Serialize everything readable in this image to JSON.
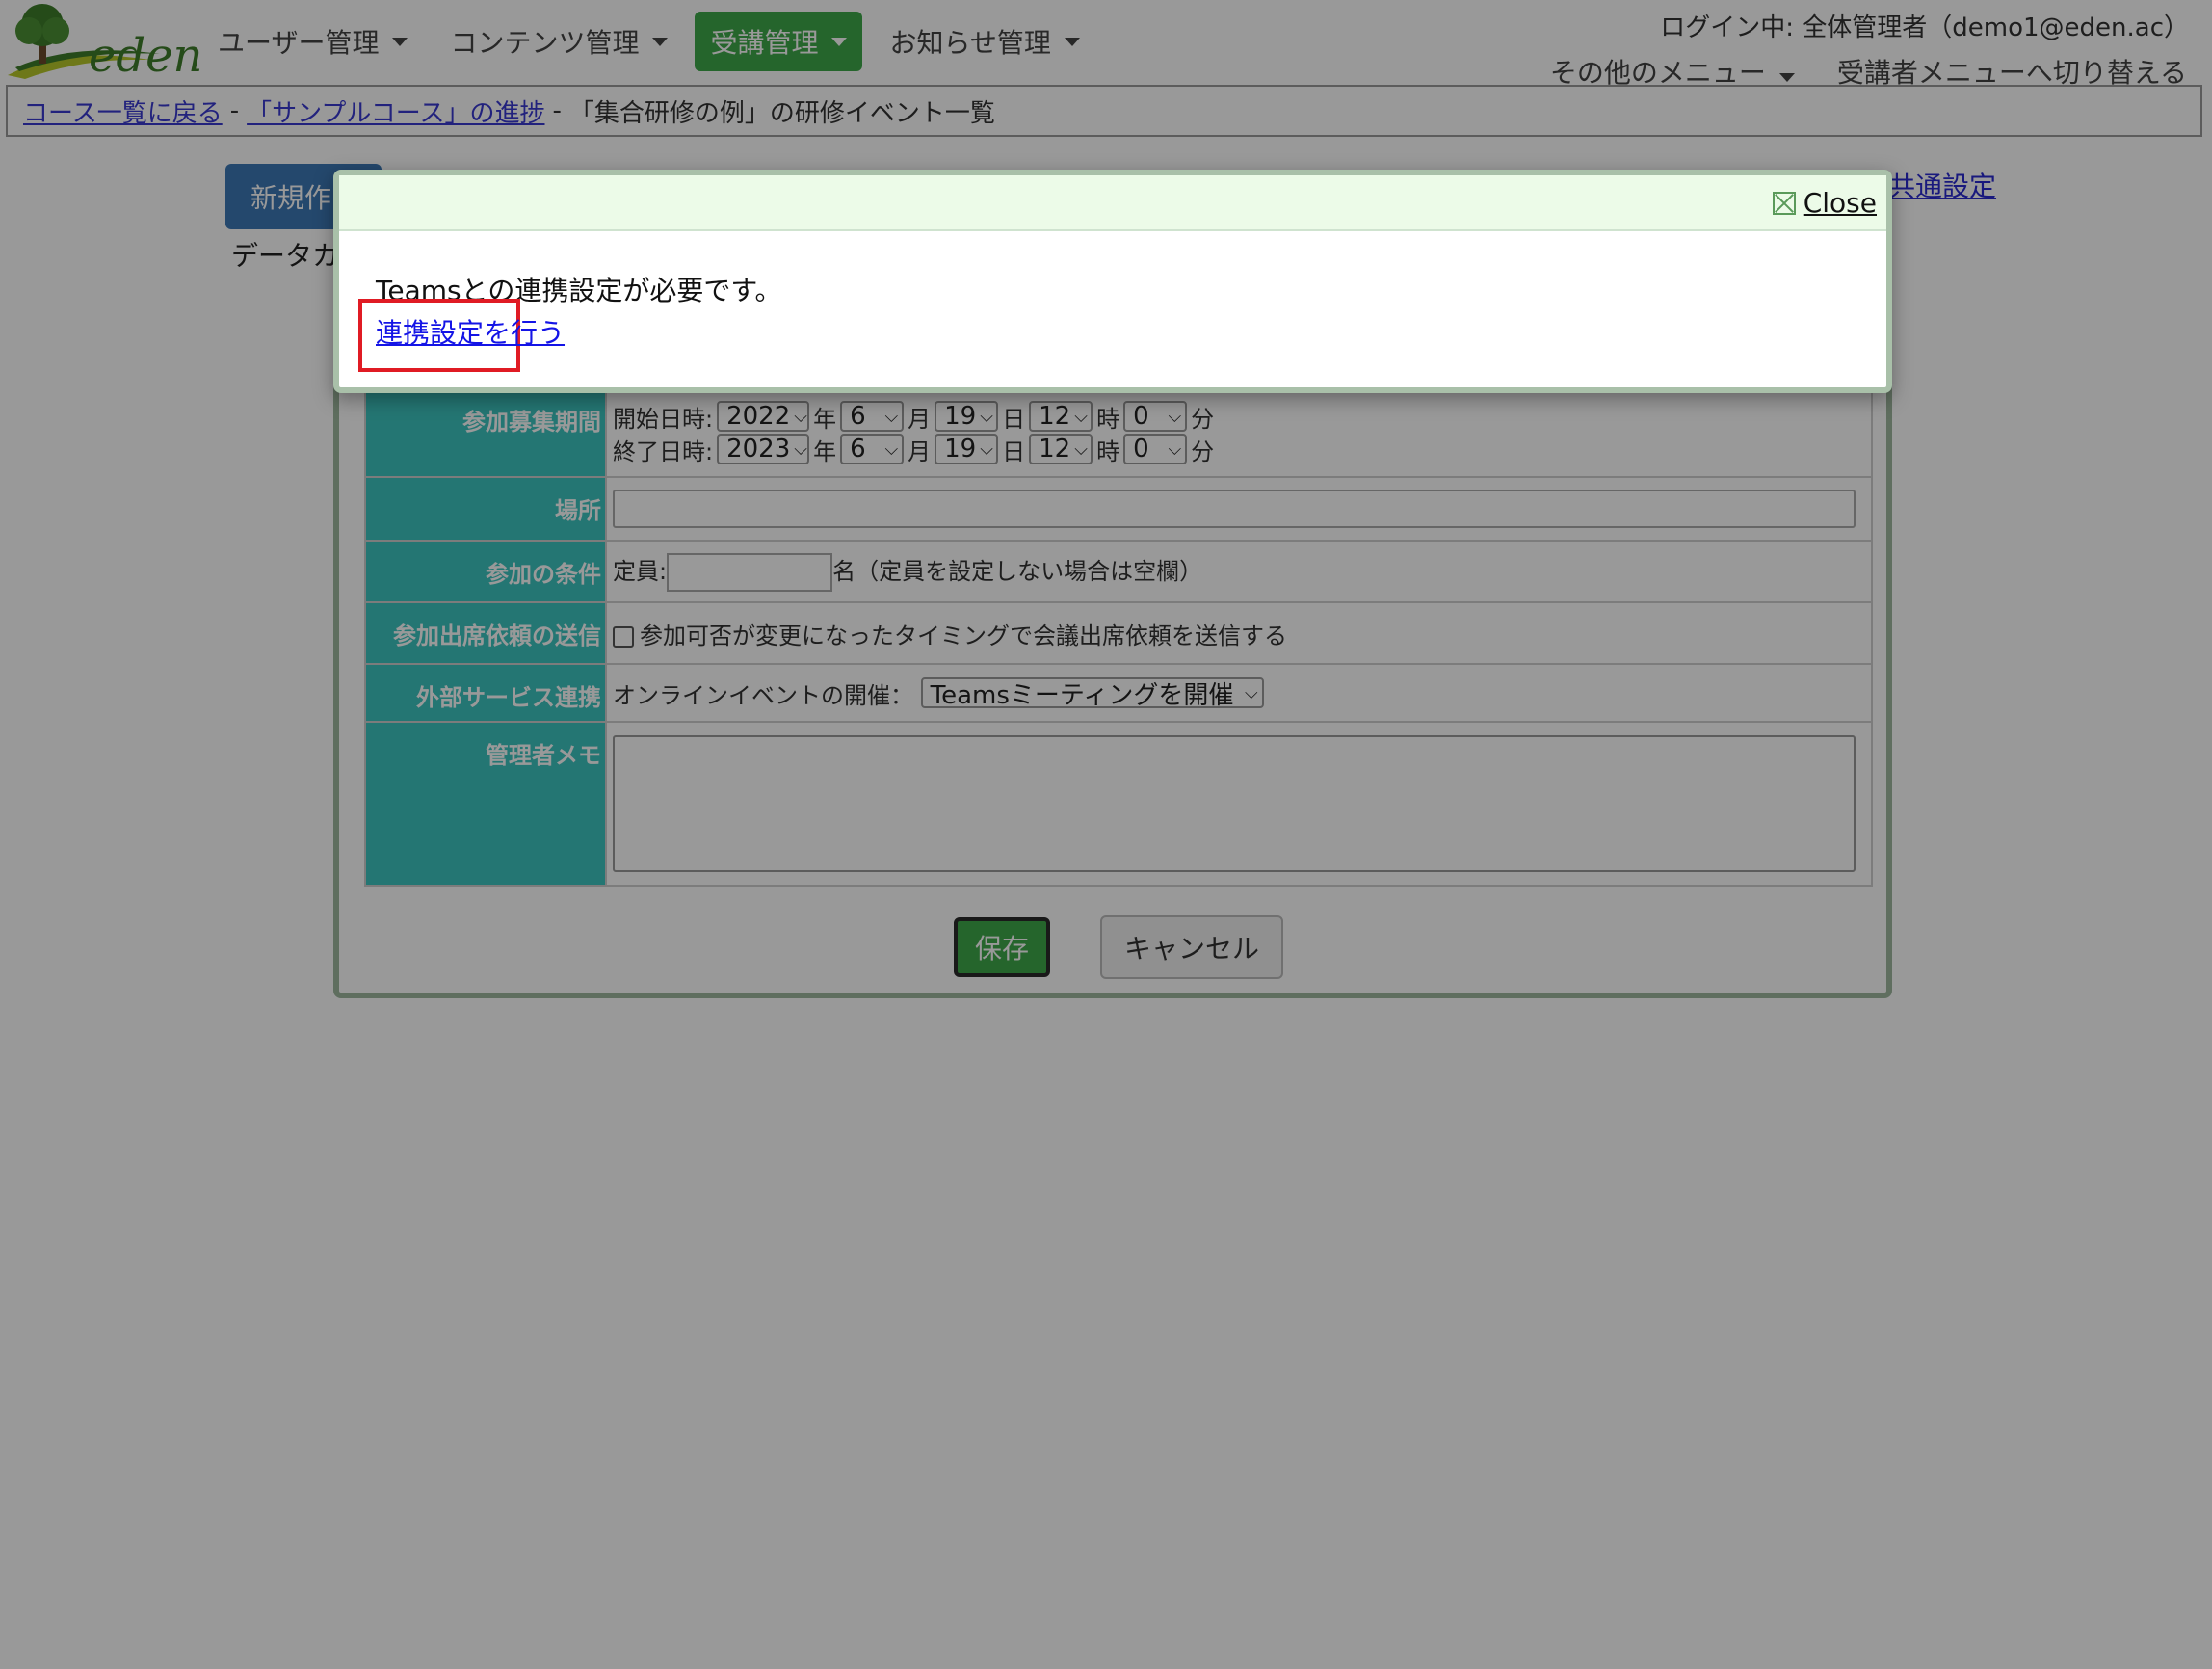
{
  "header": {
    "logo_text": "eden",
    "nav": [
      {
        "label": "ユーザー管理"
      },
      {
        "label": "コンテンツ管理"
      },
      {
        "label": "受講管理"
      },
      {
        "label": "お知らせ管理"
      }
    ],
    "login_info": "ログイン中: 全体管理者（demo1@eden.ac）",
    "other_menu": "その他のメニュー",
    "switch_menu": "受講者メニューへ切り替える"
  },
  "breadcrumb": {
    "item1": "コース一覧に戻る",
    "item2": "「サンプルコース」の進捗",
    "item3": "「集合研修の例」の研修イベント一覧",
    "sep": "-"
  },
  "page": {
    "new_button": "新規作",
    "data_text": "データカ",
    "common_settings_link": "共通設定"
  },
  "form": {
    "recruit_label": "参加募集期間",
    "start_label": "開始日時:",
    "end_label": "終了日時:",
    "start": {
      "year": "2022",
      "month": "6",
      "day": "19",
      "hour": "12",
      "minute": "0"
    },
    "end": {
      "year": "2023",
      "month": "6",
      "day": "19",
      "hour": "12",
      "minute": "0"
    },
    "unit_year": "年",
    "unit_month": "月",
    "unit_day": "日",
    "unit_hour": "時",
    "unit_minute": "分",
    "place_label": "場所",
    "condition_label": "参加の条件",
    "capacity_label": "定員:",
    "capacity_note": "名（定員を設定しない場合は空欄）",
    "attendance_label": "参加出席依頼の送信",
    "attendance_text": "参加可否が変更になったタイミングで会議出席依頼を送信する",
    "external_label": "外部サービス連携",
    "online_label": "オンラインイベントの開催：",
    "online_select": "Teamsミーティングを開催",
    "memo_label": "管理者メモ",
    "save": "保存",
    "cancel": "キャンセル"
  },
  "modal": {
    "close": "Close",
    "message": "Teamsとの連携設定が必要です。",
    "link": "連携設定を行う"
  }
}
